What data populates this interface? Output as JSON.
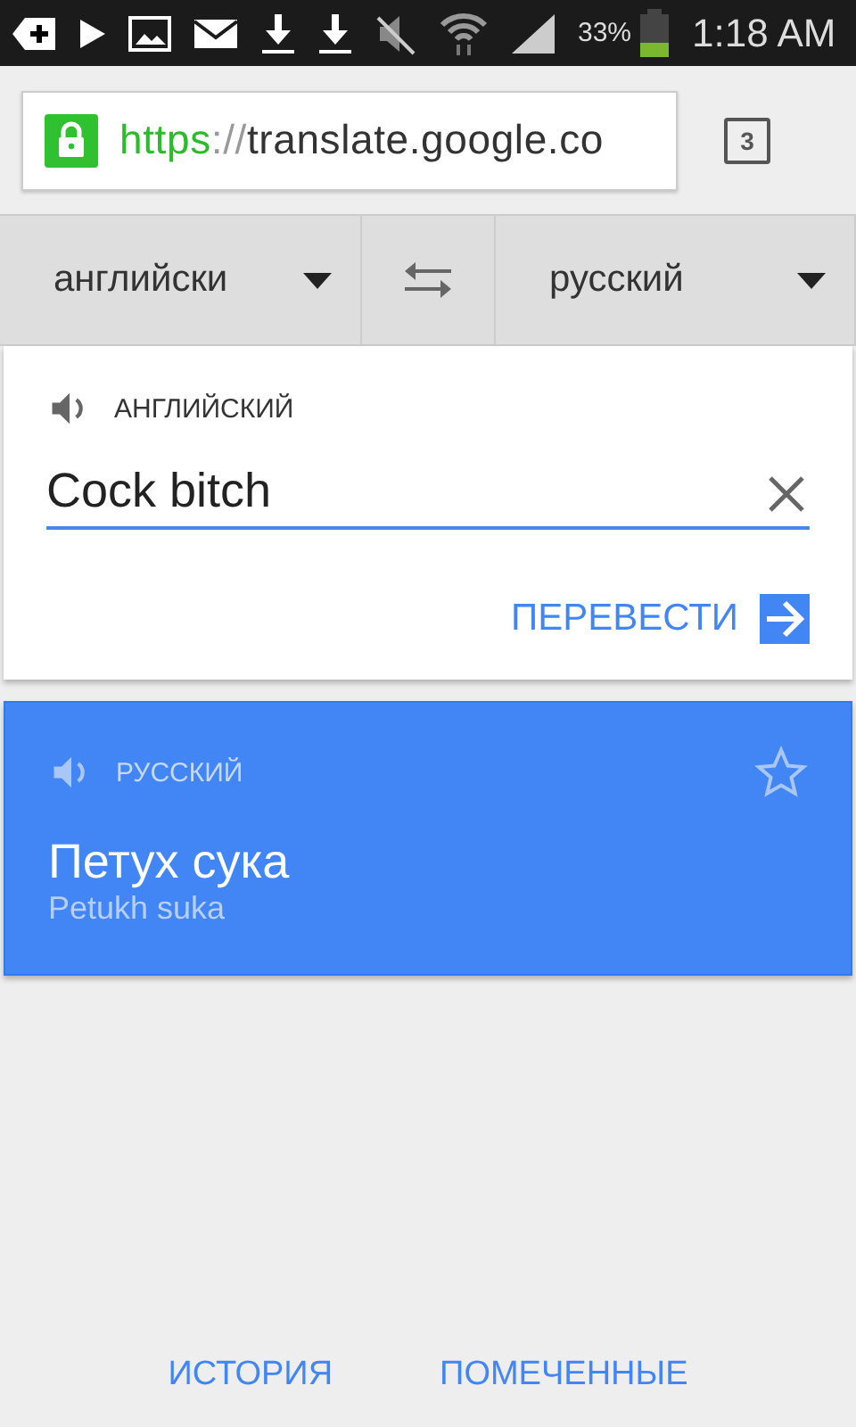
{
  "status_bar": {
    "battery_text": "33%",
    "time": "1:18 AM"
  },
  "browser": {
    "url_scheme": "https",
    "url_separator": "://",
    "url_host": "translate.google.co",
    "tab_count": "3"
  },
  "language_bar": {
    "source": "английски",
    "target": "русский"
  },
  "input_card": {
    "language": "АНГЛИЙСКИЙ",
    "value": "Cock bitch",
    "translate_button": "ПЕРЕВЕСТИ"
  },
  "result_card": {
    "language": "РУССКИЙ",
    "translation": "Петух сука",
    "transliteration": "Petukh suka",
    "starred": false
  },
  "footer": [
    {
      "label": "ИСТОРИЯ"
    },
    {
      "label": "ПОМЕЧЕННЫЕ"
    }
  ]
}
